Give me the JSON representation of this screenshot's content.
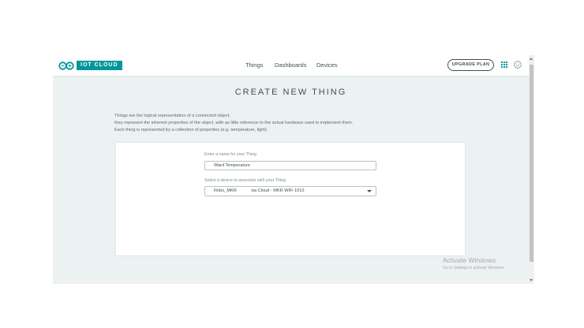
{
  "header": {
    "logo_text": "IOT CLOUD",
    "nav": [
      "Things",
      "Dashboards",
      "Devices"
    ],
    "upgrade_label": "UPGRADE PLAN",
    "brand_color": "#00979c"
  },
  "main": {
    "title": "CREATE NEW THING",
    "description": [
      "Things are the logical representation of a connected object,",
      "they represent the inherent properties of the object, with as little reference to the actual hardware used to implement them.",
      "Each thing is represented by a collection of properties (e.g. temperature, light)."
    ],
    "form": {
      "name_label": "Enter a name for your Thing",
      "name_value": "Ward Temperature",
      "device_label": "Select a device to associate with your Thing",
      "device_name": "Robo_MKR",
      "device_detail": "via Cloud - MKR WiFi 1010"
    }
  },
  "watermark": {
    "line1": "Activate Windows",
    "line2": "Go to Settings to activate Windows."
  }
}
